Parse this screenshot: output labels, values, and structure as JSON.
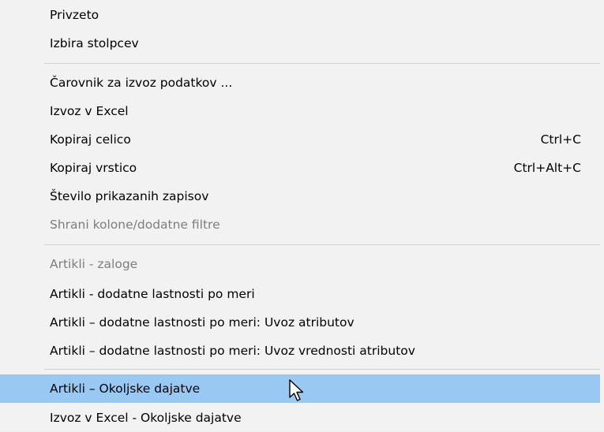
{
  "menu": {
    "items": [
      {
        "label": "Privzeto",
        "shortcut": "",
        "state": "normal"
      },
      {
        "label": "Izbira stolpcev",
        "shortcut": "",
        "state": "normal"
      },
      {
        "label": "Čarovnik za izvoz podatkov ...",
        "shortcut": "",
        "state": "normal"
      },
      {
        "label": "Izvoz v Excel",
        "shortcut": "",
        "state": "normal"
      },
      {
        "label": "Kopiraj celico",
        "shortcut": "Ctrl+C",
        "state": "normal"
      },
      {
        "label": "Kopiraj vrstico",
        "shortcut": "Ctrl+Alt+C",
        "state": "normal"
      },
      {
        "label": "Število prikazanih zapisov",
        "shortcut": "",
        "state": "normal"
      },
      {
        "label": "Shrani kolone/dodatne filtre",
        "shortcut": "",
        "state": "disabled"
      },
      {
        "label": "Artikli - zaloge",
        "shortcut": "",
        "state": "disabled"
      },
      {
        "label": "Artikli - dodatne lastnosti po meri",
        "shortcut": "",
        "state": "normal"
      },
      {
        "label": "Artikli – dodatne lastnosti po meri: Uvoz atributov",
        "shortcut": "",
        "state": "normal"
      },
      {
        "label": "Artikli – dodatne lastnosti po meri: Uvoz vrednosti atributov",
        "shortcut": "",
        "state": "normal"
      },
      {
        "label": "Artikli – Okoljske dajatve",
        "shortcut": "",
        "state": "highlighted"
      },
      {
        "label": "Izvoz v Excel - Okoljske dajatve",
        "shortcut": "",
        "state": "normal"
      }
    ]
  },
  "colors": {
    "menu_background": "#f2f2f2",
    "highlight": "#99c9f3",
    "disabled_text": "#7d7d7d",
    "separator": "#d2d2d2"
  },
  "icons": {
    "cursor": "mouse-pointer-icon"
  }
}
